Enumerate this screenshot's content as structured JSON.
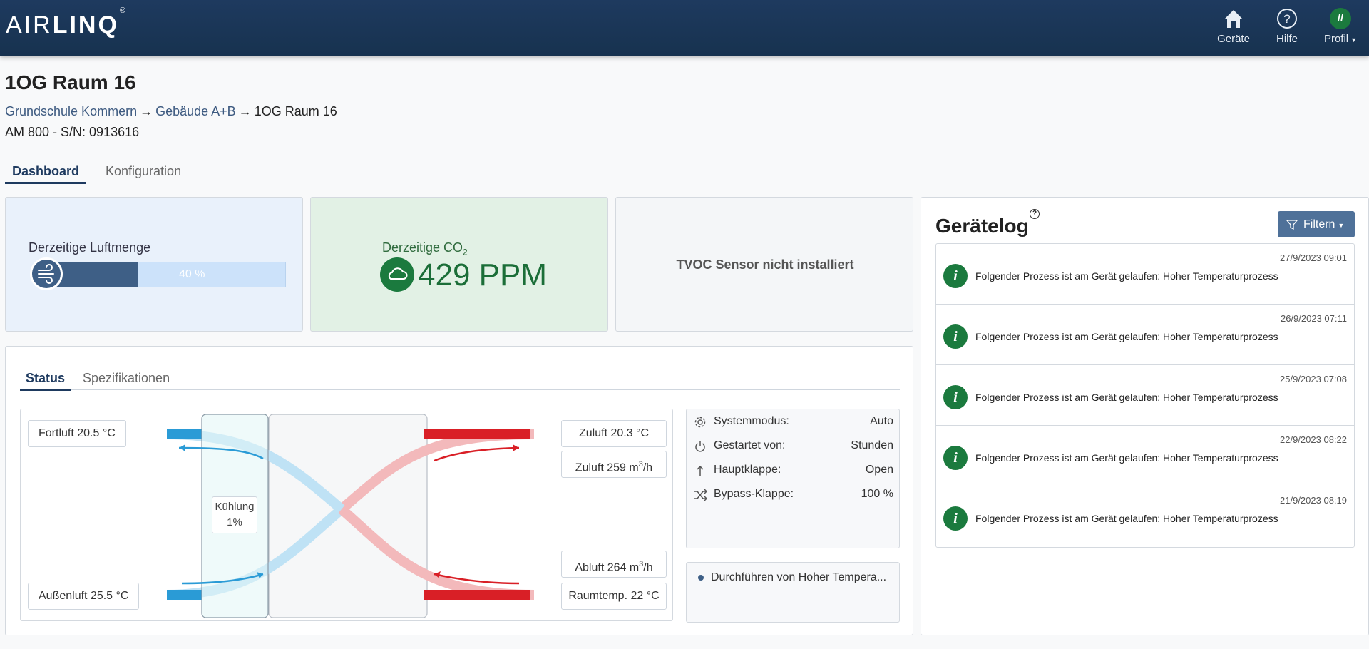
{
  "app": {
    "logo_light": "AIR",
    "logo_bold": "LINQ",
    "logo_mark": "®"
  },
  "nav": [
    {
      "label": "Geräte",
      "icon": "home-icon"
    },
    {
      "label": "Hilfe",
      "icon": "help-icon"
    },
    {
      "label": "Profil",
      "icon": "profile-avatar",
      "avatar_text": "//"
    }
  ],
  "page": {
    "title": "1OG Raum 16",
    "breadcrumb": [
      {
        "label": "Grundschule Kommern",
        "link": true
      },
      {
        "label": "Gebäude A+B",
        "link": true
      },
      {
        "label": "1OG Raum 16",
        "link": false
      }
    ],
    "breadcrumb_sep": "→",
    "device": "AM 800 - S/N: 0913616"
  },
  "tabs": [
    {
      "label": "Dashboard",
      "active": true
    },
    {
      "label": "Konfiguration",
      "active": false
    }
  ],
  "air_card": {
    "label": "Derzeitige Luftmenge",
    "percent": 40,
    "percent_text": "40 %",
    "icon": "fan-icon"
  },
  "co2_card": {
    "label": "Derzeitige CO",
    "label_sub": "2",
    "value": "429 PPM",
    "icon": "cloud-icon"
  },
  "tvoc_card": {
    "text": "TVOC Sensor nicht installiert"
  },
  "status_tabs": [
    {
      "label": "Status",
      "active": true
    },
    {
      "label": "Spezifikationen",
      "active": false
    }
  ],
  "diagram": {
    "fortluft": "Fortluft 20.5 °C",
    "aussenluft": "Außenluft 25.5 °C",
    "zuluft_temp": "Zuluft 20.3 °C",
    "zuluft_flow": "Zuluft 259 m",
    "zuluft_flow_sup": "3",
    "zuluft_flow_unit": "/h",
    "abluft_flow": "Abluft 264 m",
    "abluft_flow_sup": "3",
    "abluft_flow_unit": "/h",
    "raumtemp": "Raumtemp. 22 °C",
    "kuehlung_label": "Kühlung",
    "kuehlung_value": "1%",
    "colors": {
      "cold": "#2a9bd6",
      "cold_light": "#bfe2f5",
      "warm": "#d91f26",
      "warm_light": "#f3b9bb"
    }
  },
  "system_info": [
    {
      "key": "Systemmodus:",
      "value": "Auto",
      "icon": "gear-icon"
    },
    {
      "key": "Gestartet von:",
      "value": "Stunden",
      "icon": "power-icon"
    },
    {
      "key": "Hauptklappe:",
      "value": "Open",
      "icon": "arrow-up-icon"
    },
    {
      "key": "Bypass-Klappe:",
      "value": "100 %",
      "icon": "shuffle-icon"
    }
  ],
  "process": {
    "text": "Durchführen von Hoher Tempera..."
  },
  "log": {
    "title": "Gerätelog",
    "help": "?",
    "filter_label": "Filtern",
    "entries": [
      {
        "timestamp": "27/9/2023 09:01",
        "message": "Folgender Prozess ist am Gerät gelaufen: Hoher Temperaturprozess"
      },
      {
        "timestamp": "26/9/2023 07:11",
        "message": "Folgender Prozess ist am Gerät gelaufen: Hoher Temperaturprozess"
      },
      {
        "timestamp": "25/9/2023 07:08",
        "message": "Folgender Prozess ist am Gerät gelaufen: Hoher Temperaturprozess"
      },
      {
        "timestamp": "22/9/2023 08:22",
        "message": "Folgender Prozess ist am Gerät gelaufen: Hoher Temperaturprozess"
      },
      {
        "timestamp": "21/9/2023 08:19",
        "message": "Folgender Prozess ist am Gerät gelaufen: Hoher Temperaturprozess"
      }
    ]
  }
}
